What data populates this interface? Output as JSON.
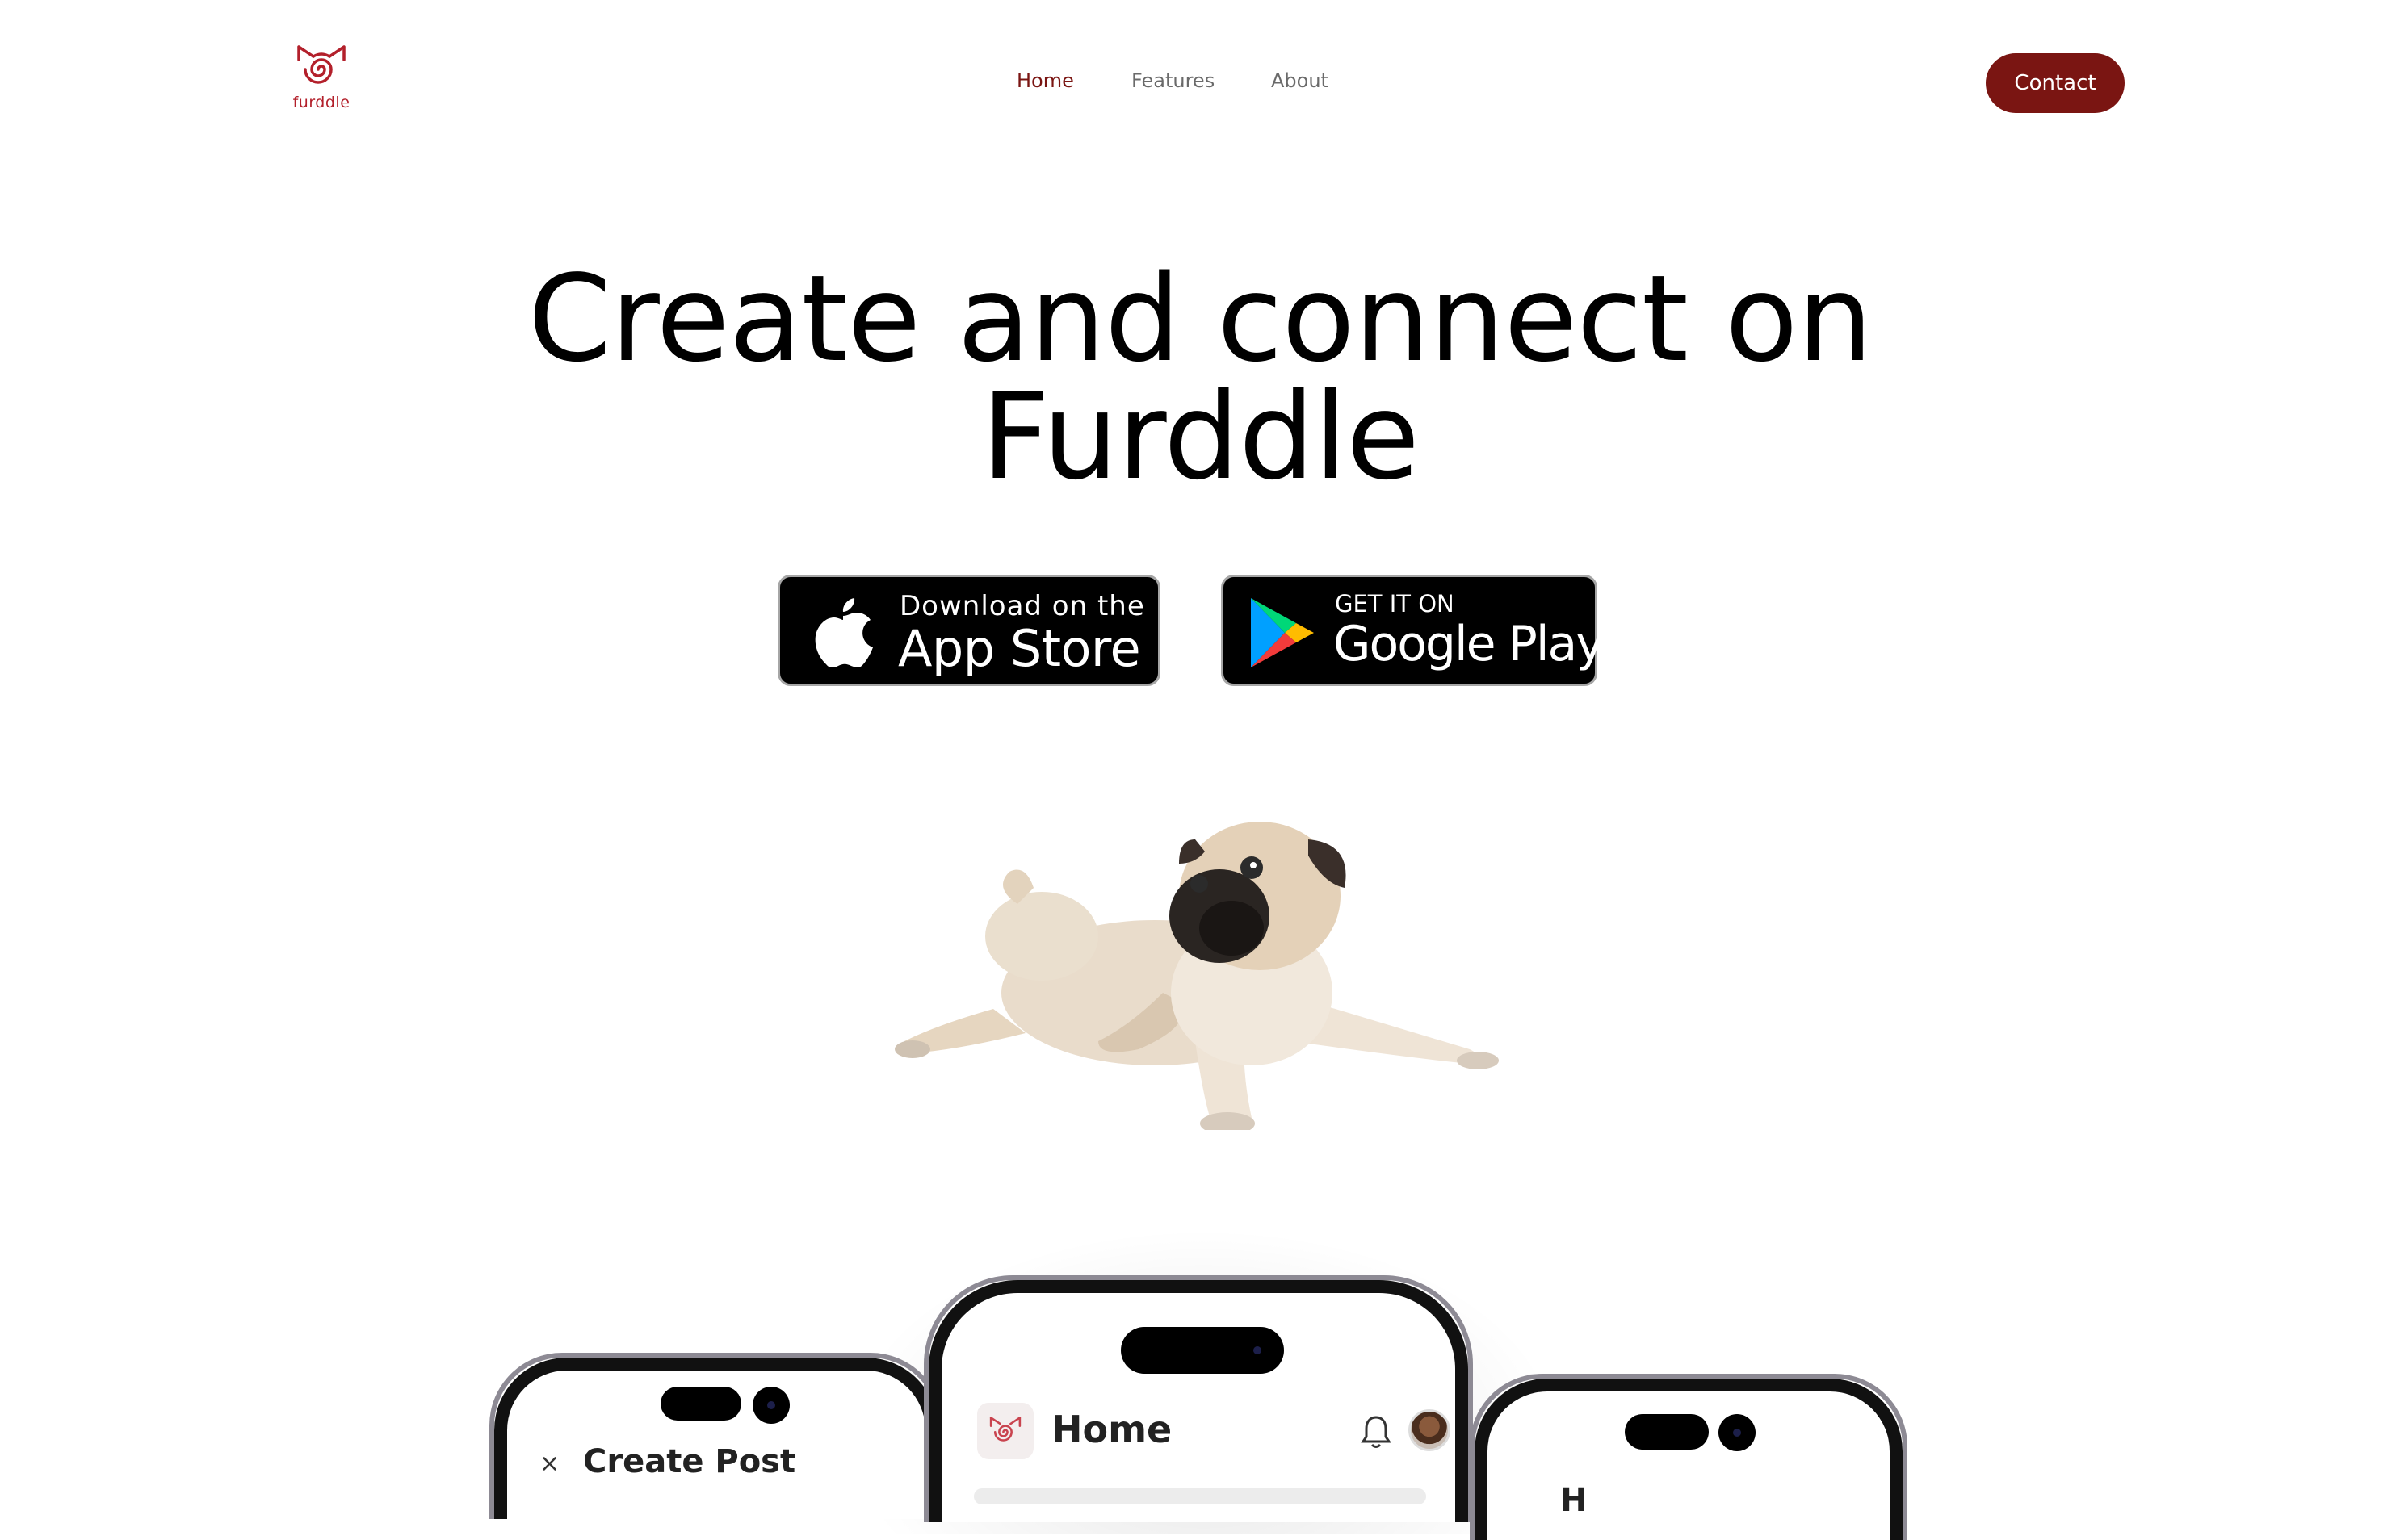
{
  "brand": {
    "name": "furddle",
    "color": "#b3202b",
    "accent": "#7a1512"
  },
  "nav": {
    "items": [
      {
        "label": "Home",
        "active": true
      },
      {
        "label": "Features",
        "active": false
      },
      {
        "label": "About",
        "active": false
      }
    ],
    "contact_label": "Contact"
  },
  "hero": {
    "title_line1": "Create and connect on",
    "title_line2": "Furddle"
  },
  "stores": {
    "appstore": {
      "small": "Download on the",
      "big": "App Store",
      "icon": "apple-icon"
    },
    "googleplay": {
      "small": "GET IT ON",
      "big": "Google Play",
      "icon": "google-play-icon"
    }
  },
  "phones": {
    "left": {
      "title": "Create Post",
      "close": "×"
    },
    "center": {
      "title": "Home"
    },
    "right": {
      "title": "H"
    }
  }
}
